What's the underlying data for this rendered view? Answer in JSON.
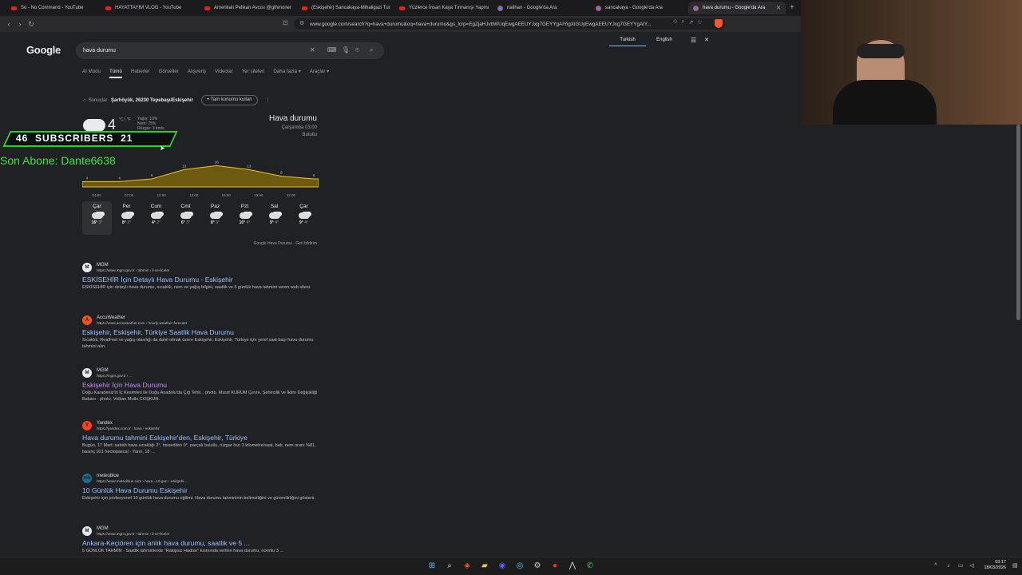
{
  "tabs": [
    {
      "title": "So - No Command - YouTube",
      "icon": "youtube-icon"
    },
    {
      "title": "HAYATTAYIM VLOG - YouTube",
      "icon": "youtube-icon"
    },
    {
      "title": "Amerikalı Pelikan Avcısı @gthmoner",
      "icon": "youtube-icon"
    },
    {
      "title": "(Eskişehir) Sancakaya-Mihaligazi Tur",
      "icon": "youtube-icon"
    },
    {
      "title": "Yüzlerce İnsan Kaya Tırmanışı Yapmı",
      "icon": "youtube-icon"
    },
    {
      "title": "nalihan - Google'da Ara",
      "icon": "google-icon"
    },
    {
      "title": "sancakaya - Google'da Ara",
      "icon": "google-icon"
    },
    {
      "title": "hava durumu - Google'da Ara",
      "icon": "google-icon"
    }
  ],
  "address": {
    "url": "www.google.com/search?q=hava+durumu&oq=hava+durumu&gs_lcrp=EgZjaHJvbWUqEwgAEEUYJxg7GEYYgAIYigXiGUyEwgAEEUYJxg7GEYYgAIY..."
  },
  "translate": {
    "lang_active": "Turkish",
    "lang_other": "English"
  },
  "google": {
    "logo": "Google",
    "query": "hava durumu",
    "tabs": [
      "AI Modu",
      "Tümü",
      "Haberler",
      "Görseller",
      "Alışveriş",
      "Videolar",
      "Yer siteleri",
      "Daha fazla",
      "Araçlar"
    ],
    "active_tab": "Tümü"
  },
  "location": {
    "label": "Sonuçlar:",
    "place": "Şarhöyük, 26230 Tepebaşı/Eskişehir",
    "button": "Tam konumu kullan"
  },
  "weather": {
    "temp": "4",
    "unit": "°C | °F",
    "details": [
      "Yağış: 10%",
      "Nem: 75%",
      "Rüzgar: 3 km/s"
    ],
    "title": "Hava durumu",
    "day": "Çarşamba 03:00",
    "condition": "Bulutlu",
    "chart_tabs": [
      "Sıcaklık",
      "Yağış",
      "Rüzgar"
    ],
    "hours": [
      "04:00",
      "07:00",
      "10:00",
      "13:00",
      "16:00",
      "19:00",
      "22:00",
      "01:00"
    ],
    "hourly_temps": [
      4,
      4,
      6,
      13,
      16,
      13,
      8,
      6
    ],
    "forecast": [
      {
        "day": "Çar",
        "hi": "16°",
        "lo": "3°"
      },
      {
        "day": "Per",
        "hi": "8°",
        "lo": "2°"
      },
      {
        "day": "Cum",
        "hi": "4°",
        "lo": "2°"
      },
      {
        "day": "Cmt",
        "hi": "6°",
        "lo": "3°"
      },
      {
        "day": "Paz",
        "hi": "8°",
        "lo": "3°"
      },
      {
        "day": "Pzt",
        "hi": "10°",
        "lo": "4°"
      },
      {
        "day": "Sal",
        "hi": "9°",
        "lo": "4°"
      },
      {
        "day": "Çar",
        "hi": "9°",
        "lo": "4°"
      }
    ],
    "footer_source": "Google Hava Durumu",
    "footer_feedback": "Geri bildirim"
  },
  "results": [
    {
      "site": "MGM",
      "url": "https://www.mgm.gov.tr › tahmin › il-ve-ilceler",
      "title": "ESKİSEHİR İçin Detaylı Hava Durumu - Eskişehir",
      "snippet": "ESKİSEHİR için detaylı hava durumu, sıcaklık, nem ve yağış bilgisi, saatlik ve 5 günlük hava tahmini veren web sitesi.",
      "fav": "M",
      "visited": false
    },
    {
      "site": "AccuWeather",
      "url": "https://www.accuweather.com › hourly-weather-forecast",
      "title": "Eskişehir, Eskişehir, Türkiye Saatlik Hava Durumu",
      "snippet": "Sıcaklık, RealFeel ve yağış olasılığı da dahil olmak üzere Eskişehir, Eskişehir, Türkiye için yerel saat başı hava durumu tahmini alın.",
      "fav": "A",
      "visited": false
    },
    {
      "site": "MGM",
      "url": "https://mgm.gov.tr › ...",
      "title": "Eskişehir İçin Hava Durumu",
      "snippet": "Doğu Karadeniz'in İç Kesimleri ile Doğu Anadolu'da Çığ Tehli... photo. Murat KURUM Çevre, Şehircilik ve İklim Değişikliği Bakanı · photo. Volkan Mutlu COŞKUN.",
      "fav": "M",
      "visited": true
    },
    {
      "site": "Yandex",
      "url": "https://yandex.com.tr › hava › eskisehir",
      "title": "Hava durumu tahmini Eskişehir'den, Eskişehir, Türkiye",
      "snippet": "Bugün, 17 Mart: sabah hava sıcaklığı 2°, hissedilen 0°, parçalı bulutlu, rüzgar hızı 3 kilometre/saat, batı, nem oranı %81, basınç 921 hectopascal · Yarın, 18 ...",
      "fav": "Y",
      "visited": false
    },
    {
      "site": "meteoblue",
      "url": "https://www.meteoblue.com › hava › 10-gun › eskişehi...",
      "title": "10 Günlük Hava Durumu Eskişehir",
      "snippet": "Eskişehir için profesyonel 10 günlük hava durumu eğilimi. Hava durumu tahmininin belirsizliğini ve güvenilirliğini gösterir.",
      "fav": "mb",
      "visited": false
    },
    {
      "site": "MGM",
      "url": "https://www.mgm.gov.tr › tahmin › il-ve-ilceler",
      "title": "Ankara-Keçiören için anlık hava durumu, saatlik ve 5 ...",
      "snippet": "5 GÜNLÜK TAHMİN · Saatlik tahminlerde \"Rakipsiz Hadise\" kısmında verilen hava durumu, normlu 3 ...",
      "fav": "M",
      "visited": false
    }
  ],
  "overlay": {
    "subs_left": "46",
    "subs_label": "SUBSCRIBERS",
    "subs_right": "21",
    "last_sub": "Son Abone: Dante6638"
  },
  "clock": {
    "time": "03:17",
    "date": "18/03/2026"
  },
  "colors": {
    "accent": "#8ab4f8",
    "link": "#99c3ff",
    "visited": "#c58af9",
    "overlay_green": "#3ee43e"
  }
}
